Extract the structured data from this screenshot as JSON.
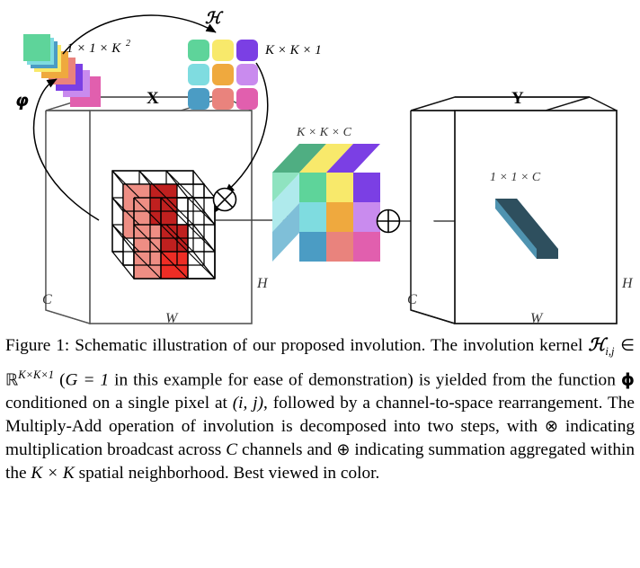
{
  "figure": {
    "labels": {
      "phi": "ϕ",
      "script_h": "ℋ",
      "kernel_vector_dim": "1 × 1 × K²",
      "kernel_grid_dim": "K × K × 1",
      "slab_dim": "K × K × C",
      "output_bar_dim": "1 × 1 × C",
      "input_tensor": "X",
      "output_tensor": "Y",
      "axis_C_input": "C",
      "axis_W_input": "W",
      "axis_H_input": "H",
      "axis_C_output": "C",
      "axis_W_output": "W",
      "axis_H_output": "H",
      "multiply_symbol": "⊗",
      "add_symbol": "⊕"
    },
    "kernel_grid_colors": [
      [
        "#5ED49A",
        "#F8E96B",
        "#7B3FE4"
      ],
      [
        "#7FDCE0",
        "#EFA93E",
        "#C98BEE"
      ],
      [
        "#4B9CC4",
        "#E9837D",
        "#E15FAE"
      ]
    ],
    "kernel_stack_colors": [
      "#5ED49A",
      "#7FDCE0",
      "#4B9CC4",
      "#F8E96B",
      "#EFA93E",
      "#E9837D",
      "#7B3FE4",
      "#C98BEE",
      "#E15FAE"
    ],
    "slab_front_colors": [
      [
        "#5ED49A",
        "#F8E96B",
        "#7B3FE4"
      ],
      [
        "#7FDCE0",
        "#EFA93E",
        "#C98BEE"
      ],
      [
        "#4B9CC4",
        "#E9837D",
        "#E15FAE"
      ]
    ],
    "slab_top_colors": [
      "#4FAE82",
      "#F8E96B",
      "#7B3FE4"
    ],
    "slab_side_colors": [
      "#8FE3C0",
      "#AFEAEC",
      "#7FBFD8"
    ],
    "input_patch_highlight": {
      "dark_red": "#C0201F",
      "mid_red": "#EE2D25",
      "light_red": "#EE8E84"
    },
    "output_bar": {
      "front_color": "#4F93B0",
      "top_color": "#2E4F5E",
      "end_color": "#2E4F5E"
    },
    "stroke_color": "#000000",
    "cube_edge_color": "#4D4D4D"
  },
  "caption": {
    "prefix": "Figure 1:",
    "text_1": " Schematic illustration of our proposed involution. The involution kernel ",
    "kernel_sym": "ℋ",
    "kernel_sub": "i,j",
    "in_sym": " ∈ ",
    "reals": "ℝ",
    "reals_sup": "K×K×1",
    "text_2": " (",
    "g_eq": "G = 1",
    "text_3": " in this example for ease of demonstration) is yielded from the function ",
    "phi": "ϕ",
    "text_4": " conditioned on a single pixel at ",
    "ij": "(i, j)",
    "text_5": ", followed by a channel-to-space rearrangement. The Multiply-Add operation of involution is decomposed into two steps, with ",
    "otimes": "⊗",
    "text_6": " indicating multiplication broadcast across ",
    "c_var": "C",
    "text_7": " channels and ",
    "oplus": "⊕",
    "text_8": " indicating summation aggregated within the ",
    "kxk": "K × K",
    "text_9": " spatial neighborhood. Best viewed in color."
  }
}
